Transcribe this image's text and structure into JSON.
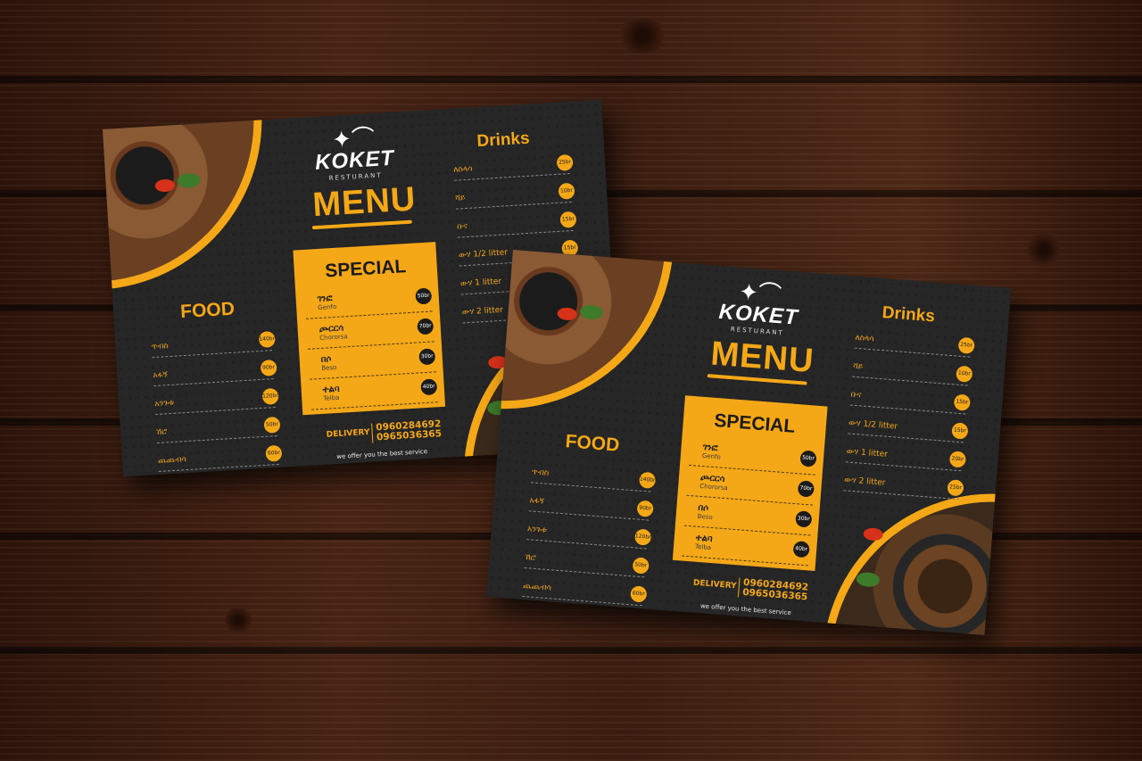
{
  "brand": {
    "name": "KOKET",
    "subtitle": "RESTURANT"
  },
  "menu_title": "MENU",
  "special": {
    "title": "SPECIAL",
    "items": [
      {
        "am": "ገንፎ",
        "en": "Genfo",
        "price": "50br"
      },
      {
        "am": "ጮርርሳ",
        "en": "Chororsa",
        "price": "70br"
      },
      {
        "am": "በሶ",
        "en": "Beso",
        "price": "30br"
      },
      {
        "am": "ተልባ",
        "en": "Telba",
        "price": "40br"
      }
    ]
  },
  "food": {
    "title": "FOOD",
    "items": [
      {
        "name": "ጥብስ",
        "price": "140br"
      },
      {
        "name": "አፋኝ",
        "price": "90br"
      },
      {
        "name": "አንጉቱ",
        "price": "120br"
      },
      {
        "name": "ሽሮ",
        "price": "50br"
      },
      {
        "name": "ጨጨብሳ",
        "price": "60br"
      }
    ]
  },
  "drinks": {
    "title": "Drinks",
    "items": [
      {
        "name": "ለስላሳ",
        "price": "25br"
      },
      {
        "name": "ሻይ",
        "price": "10br"
      },
      {
        "name": "ቡና",
        "price": "15br"
      },
      {
        "name": "ውሃ 1/2 litter",
        "price": "15br"
      },
      {
        "name": "ውሃ 1 litter",
        "price": "20br"
      },
      {
        "name": "ውሃ 2 litter",
        "price": "25br"
      }
    ]
  },
  "delivery": {
    "label": "DELIVERY",
    "phone1": "0960284692",
    "phone2": "0965036365"
  },
  "tagline": "we offer you the best service",
  "colors": {
    "accent": "#f5a817",
    "sheet": "#262626",
    "wood": "#3b1d10"
  }
}
